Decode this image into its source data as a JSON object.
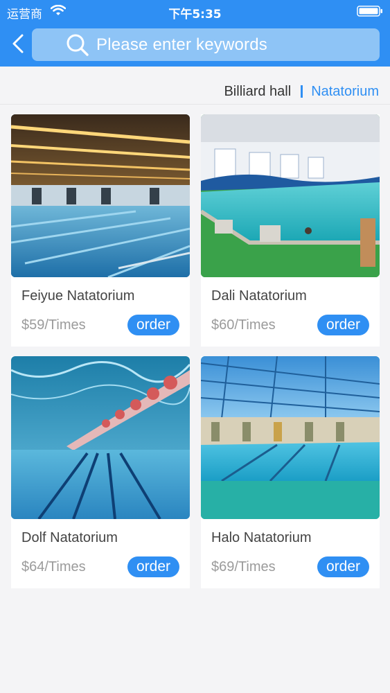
{
  "status_bar": {
    "carrier": "运营商",
    "time": "下午5:35"
  },
  "header": {
    "search_placeholder": "Please enter keywords"
  },
  "tabs": [
    {
      "label": "Billiard hall",
      "active": false
    },
    {
      "label": "Natatorium",
      "active": true
    }
  ],
  "venues": [
    {
      "name": "Feiyue Natatorium",
      "price": "$59/Times",
      "order_label": "order"
    },
    {
      "name": "Dali Natatorium",
      "price": "$60/Times",
      "order_label": "order"
    },
    {
      "name": "Dolf Natatorium",
      "price": "$64/Times",
      "order_label": "order"
    },
    {
      "name": "Halo Natatorium",
      "price": "$69/Times",
      "order_label": "order"
    }
  ],
  "colors": {
    "accent": "#2f8ff3",
    "search_bg": "#8ec4f6",
    "page_bg": "#f4f4f6"
  }
}
